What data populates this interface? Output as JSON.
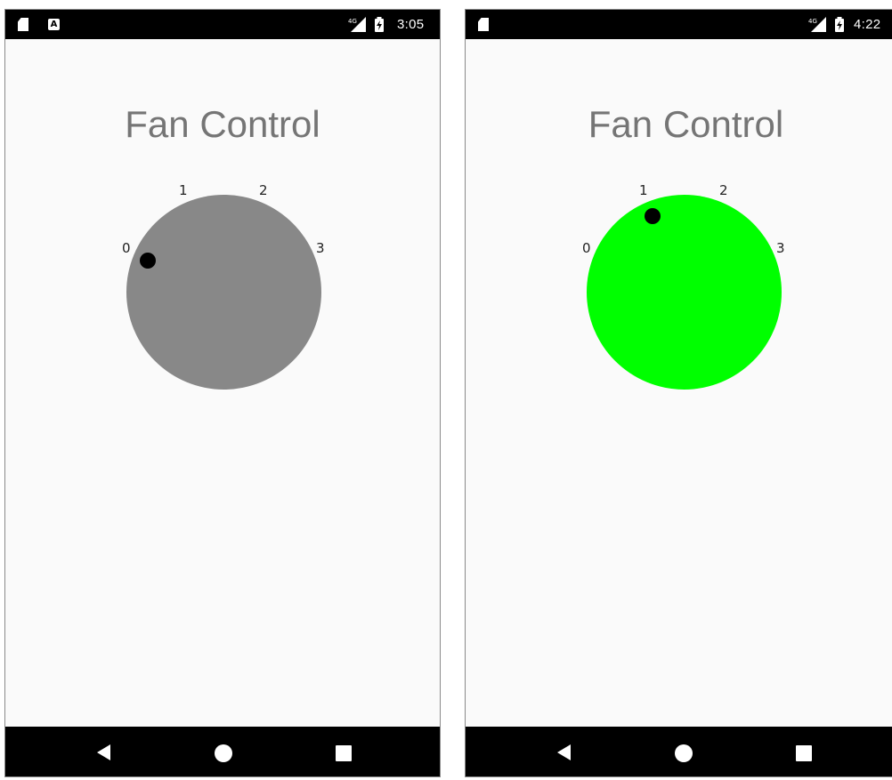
{
  "screens": [
    {
      "status_bar": {
        "time": "3:05",
        "network": "4G",
        "icons": [
          "sd-card-icon",
          "a-notification-icon",
          "signal-icon",
          "battery-charging-icon"
        ]
      },
      "title": "Fan Control",
      "dial": {
        "labels": [
          "0",
          "1",
          "2",
          "3"
        ],
        "selected_level": 0,
        "color": "#888888"
      },
      "nav": {
        "icons": [
          "back-icon",
          "home-icon",
          "recents-icon"
        ]
      }
    },
    {
      "status_bar": {
        "time": "4:22",
        "network": "4G",
        "icons": [
          "sd-card-icon",
          "signal-icon",
          "battery-charging-icon"
        ]
      },
      "title": "Fan Control",
      "dial": {
        "labels": [
          "0",
          "1",
          "2",
          "3"
        ],
        "selected_level": 1,
        "color": "#00ff00"
      },
      "nav": {
        "icons": [
          "back-icon",
          "home-icon",
          "recents-icon"
        ]
      }
    }
  ],
  "colors": {
    "status_bar_bg": "#000000",
    "screen_bg": "#fafafa",
    "title_text": "#757575",
    "knob_indicator": "#000000"
  }
}
